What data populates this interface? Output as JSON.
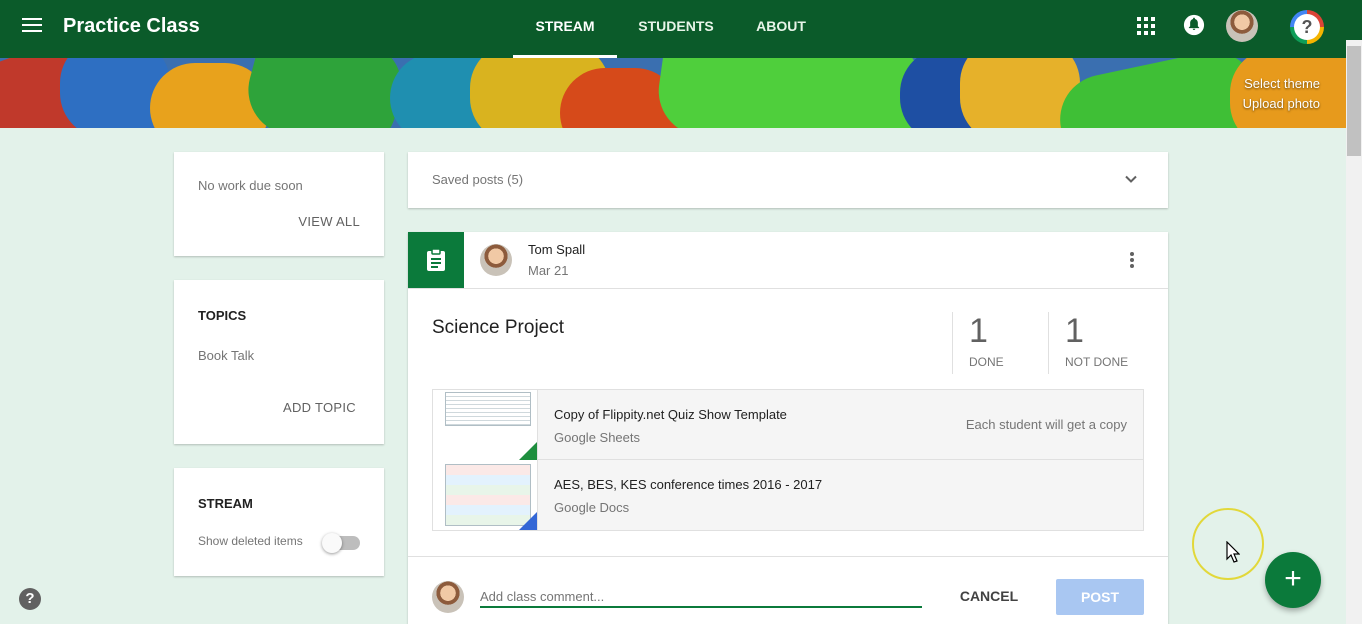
{
  "header": {
    "title": "Practice Class",
    "tabs": [
      {
        "label": "STREAM",
        "active": true
      },
      {
        "label": "STUDENTS",
        "active": false
      },
      {
        "label": "ABOUT",
        "active": false
      }
    ],
    "icons": [
      "menu-icon",
      "apps-icon",
      "notifications-bell-icon",
      "user-avatar",
      "help-icon"
    ]
  },
  "banner": {
    "select_theme": "Select theme",
    "upload_photo": "Upload photo"
  },
  "sidebar": {
    "upcoming": {
      "empty_text": "No work due soon",
      "view_all": "VIEW ALL"
    },
    "topics": {
      "title": "TOPICS",
      "items": [
        "Book Talk"
      ],
      "add_topic": "ADD TOPIC"
    },
    "stream": {
      "title": "STREAM",
      "toggle_label": "Show deleted items",
      "toggle_on": false
    }
  },
  "saved_posts": {
    "label": "Saved posts (5)"
  },
  "post": {
    "author": "Tom Spall",
    "date": "Mar 21",
    "title": "Science Project",
    "done_count": "1",
    "done_label": "DONE",
    "not_done_count": "1",
    "not_done_label": "NOT DONE",
    "attachments": [
      {
        "name": "Copy of Flippity.net Quiz Show Template",
        "type": "Google Sheets",
        "note": "Each student will get a copy"
      },
      {
        "name": "AES, BES, KES conference times 2016 - 2017",
        "type": "Google Docs",
        "note": ""
      }
    ],
    "comment_placeholder": "Add class comment...",
    "cancel_label": "CANCEL",
    "post_label": "POST"
  },
  "fab": {
    "label": "+"
  },
  "help": {
    "label": "?"
  },
  "colors": {
    "primary": "#0b5b2a",
    "accent": "#0b7a3b",
    "background": "#e3f2ea",
    "post_button": "#a9c7f2"
  }
}
